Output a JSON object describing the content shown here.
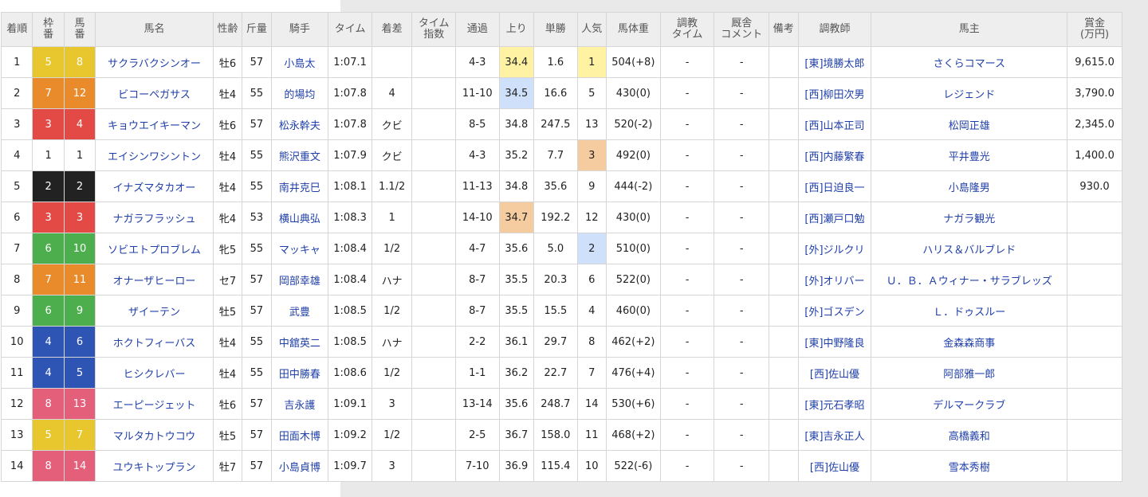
{
  "headers": [
    "着順",
    "枠番",
    "馬番",
    "馬名",
    "性齢",
    "斤量",
    "騎手",
    "タイム",
    "着差",
    "タイム指数",
    "通過",
    "上り",
    "単勝",
    "人気",
    "馬体重",
    "調教タイム",
    "厩舎コメント",
    "備考",
    "調教師",
    "馬主",
    "賞金(万円)"
  ],
  "header_lines": {
    "waku": [
      "枠",
      "番"
    ],
    "uma": [
      "馬",
      "番"
    ],
    "index": [
      "タイム",
      "指数"
    ],
    "training": [
      "調教",
      "タイム"
    ],
    "comment": [
      "厩舎",
      "コメント"
    ],
    "prize": [
      "賞金",
      "(万円)"
    ]
  },
  "colors": {
    "waku_1": "#ffffff",
    "waku_2": "#222222",
    "waku_3": "#e34a45",
    "waku_4": "#2f55b4",
    "waku_5": "#e8c72e",
    "waku_6": "#4cae4c",
    "waku_7": "#e98a2b",
    "waku_8": "#e45f7a",
    "highlight_yellow": "#fff3a3",
    "highlight_blue": "#cfe0fb",
    "highlight_orange": "#f5cc9f",
    "link": "#1f3fa8"
  },
  "rows": [
    {
      "rank": "1",
      "waku": "5",
      "uma": "8",
      "name": "サクラバクシンオー",
      "sex_age": "牡6",
      "weight": "57",
      "jockey": "小島太",
      "time": "1:07.1",
      "margin": "",
      "index": "",
      "passing": "4-3",
      "last3f": "34.4",
      "odds": "1.6",
      "pop": "1",
      "body": "504(+8)",
      "train": "-",
      "comment": "-",
      "note": "",
      "trainer": "[東]境勝太郎",
      "owner": "さくらコマース",
      "prize": "9,615.0",
      "hl_last": "yellow",
      "hl_pop": "yellow"
    },
    {
      "rank": "2",
      "waku": "7",
      "uma": "12",
      "name": "ビコーペガサス",
      "sex_age": "牡4",
      "weight": "55",
      "jockey": "的場均",
      "time": "1:07.8",
      "margin": "4",
      "index": "",
      "passing": "11-10",
      "last3f": "34.5",
      "odds": "16.6",
      "pop": "5",
      "body": "430(0)",
      "train": "-",
      "comment": "-",
      "note": "",
      "trainer": "[西]柳田次男",
      "owner": "レジェンド",
      "prize": "3,790.0",
      "hl_last": "blue",
      "hl_pop": ""
    },
    {
      "rank": "3",
      "waku": "3",
      "uma": "4",
      "name": "キョウエイキーマン",
      "sex_age": "牡6",
      "weight": "57",
      "jockey": "松永幹夫",
      "time": "1:07.8",
      "margin": "クビ",
      "index": "",
      "passing": "8-5",
      "last3f": "34.8",
      "odds": "247.5",
      "pop": "13",
      "body": "520(-2)",
      "train": "-",
      "comment": "-",
      "note": "",
      "trainer": "[西]山本正司",
      "owner": "松岡正雄",
      "prize": "2,345.0",
      "hl_last": "",
      "hl_pop": ""
    },
    {
      "rank": "4",
      "waku": "1",
      "uma": "1",
      "name": "エイシンワシントン",
      "sex_age": "牡4",
      "weight": "55",
      "jockey": "熊沢重文",
      "time": "1:07.9",
      "margin": "クビ",
      "index": "",
      "passing": "4-3",
      "last3f": "35.2",
      "odds": "7.7",
      "pop": "3",
      "body": "492(0)",
      "train": "-",
      "comment": "-",
      "note": "",
      "trainer": "[西]内藤繁春",
      "owner": "平井豊光",
      "prize": "1,400.0",
      "hl_last": "",
      "hl_pop": "orange"
    },
    {
      "rank": "5",
      "waku": "2",
      "uma": "2",
      "name": "イナズマタカオー",
      "sex_age": "牡4",
      "weight": "55",
      "jockey": "南井克巳",
      "time": "1:08.1",
      "margin": "1.1/2",
      "index": "",
      "passing": "11-13",
      "last3f": "34.8",
      "odds": "35.6",
      "pop": "9",
      "body": "444(-2)",
      "train": "-",
      "comment": "-",
      "note": "",
      "trainer": "[西]日迫良一",
      "owner": "小島隆男",
      "prize": "930.0",
      "hl_last": "",
      "hl_pop": ""
    },
    {
      "rank": "6",
      "waku": "3",
      "uma": "3",
      "name": "ナガラフラッシュ",
      "sex_age": "牝4",
      "weight": "53",
      "jockey": "横山典弘",
      "time": "1:08.3",
      "margin": "1",
      "index": "",
      "passing": "14-10",
      "last3f": "34.7",
      "odds": "192.2",
      "pop": "12",
      "body": "430(0)",
      "train": "-",
      "comment": "-",
      "note": "",
      "trainer": "[西]瀬戸口勉",
      "owner": "ナガラ観光",
      "prize": "",
      "hl_last": "orange",
      "hl_pop": ""
    },
    {
      "rank": "7",
      "waku": "6",
      "uma": "10",
      "name": "ソビエトプロブレム",
      "sex_age": "牝5",
      "weight": "55",
      "jockey": "マッキャ",
      "time": "1:08.4",
      "margin": "1/2",
      "index": "",
      "passing": "4-7",
      "last3f": "35.6",
      "odds": "5.0",
      "pop": "2",
      "body": "510(0)",
      "train": "-",
      "comment": "-",
      "note": "",
      "trainer": "[外]ジルクリ",
      "owner": "ハリス＆バルブレド",
      "prize": "",
      "hl_last": "",
      "hl_pop": "blue"
    },
    {
      "rank": "8",
      "waku": "7",
      "uma": "11",
      "name": "オナーザヒーロー",
      "sex_age": "セ7",
      "weight": "57",
      "jockey": "岡部幸雄",
      "time": "1:08.4",
      "margin": "ハナ",
      "index": "",
      "passing": "8-7",
      "last3f": "35.5",
      "odds": "20.3",
      "pop": "6",
      "body": "522(0)",
      "train": "-",
      "comment": "-",
      "note": "",
      "trainer": "[外]オリバー",
      "owner": "Ｕ．Ｂ．Ａウィナー・サラブレッズ",
      "prize": "",
      "hl_last": "",
      "hl_pop": ""
    },
    {
      "rank": "9",
      "waku": "6",
      "uma": "9",
      "name": "ザイーテン",
      "sex_age": "牡5",
      "weight": "57",
      "jockey": "武豊",
      "time": "1:08.5",
      "margin": "1/2",
      "index": "",
      "passing": "8-7",
      "last3f": "35.5",
      "odds": "15.5",
      "pop": "4",
      "body": "460(0)",
      "train": "-",
      "comment": "-",
      "note": "",
      "trainer": "[外]ゴスデン",
      "owner": "Ｌ．ドゥスルー",
      "prize": "",
      "hl_last": "",
      "hl_pop": ""
    },
    {
      "rank": "10",
      "waku": "4",
      "uma": "6",
      "name": "ホクトフィーバス",
      "sex_age": "牡4",
      "weight": "55",
      "jockey": "中舘英二",
      "time": "1:08.5",
      "margin": "ハナ",
      "index": "",
      "passing": "2-2",
      "last3f": "36.1",
      "odds": "29.7",
      "pop": "8",
      "body": "462(+2)",
      "train": "-",
      "comment": "-",
      "note": "",
      "trainer": "[東]中野隆良",
      "owner": "金森森商事",
      "prize": "",
      "hl_last": "",
      "hl_pop": ""
    },
    {
      "rank": "11",
      "waku": "4",
      "uma": "5",
      "name": "ヒシクレバー",
      "sex_age": "牡4",
      "weight": "55",
      "jockey": "田中勝春",
      "time": "1:08.6",
      "margin": "1/2",
      "index": "",
      "passing": "1-1",
      "last3f": "36.2",
      "odds": "22.7",
      "pop": "7",
      "body": "476(+4)",
      "train": "-",
      "comment": "-",
      "note": "",
      "trainer": "[西]佐山優",
      "owner": "阿部雅一郎",
      "prize": "",
      "hl_last": "",
      "hl_pop": ""
    },
    {
      "rank": "12",
      "waku": "8",
      "uma": "13",
      "name": "エーピージェット",
      "sex_age": "牡6",
      "weight": "57",
      "jockey": "吉永護",
      "time": "1:09.1",
      "margin": "3",
      "index": "",
      "passing": "13-14",
      "last3f": "35.6",
      "odds": "248.7",
      "pop": "14",
      "body": "530(+6)",
      "train": "-",
      "comment": "-",
      "note": "",
      "trainer": "[東]元石孝昭",
      "owner": "デルマークラブ",
      "prize": "",
      "hl_last": "",
      "hl_pop": ""
    },
    {
      "rank": "13",
      "waku": "5",
      "uma": "7",
      "name": "マルタカトウコウ",
      "sex_age": "牡5",
      "weight": "57",
      "jockey": "田面木博",
      "time": "1:09.2",
      "margin": "1/2",
      "index": "",
      "passing": "2-5",
      "last3f": "36.7",
      "odds": "158.0",
      "pop": "11",
      "body": "468(+2)",
      "train": "-",
      "comment": "-",
      "note": "",
      "trainer": "[東]吉永正人",
      "owner": "高橋義和",
      "prize": "",
      "hl_last": "",
      "hl_pop": ""
    },
    {
      "rank": "14",
      "waku": "8",
      "uma": "14",
      "name": "ユウキトップラン",
      "sex_age": "牡7",
      "weight": "57",
      "jockey": "小島貞博",
      "time": "1:09.7",
      "margin": "3",
      "index": "",
      "passing": "7-10",
      "last3f": "36.9",
      "odds": "115.4",
      "pop": "10",
      "body": "522(-6)",
      "train": "-",
      "comment": "-",
      "note": "",
      "trainer": "[西]佐山優",
      "owner": "雪本秀樹",
      "prize": "",
      "hl_last": "",
      "hl_pop": ""
    }
  ]
}
